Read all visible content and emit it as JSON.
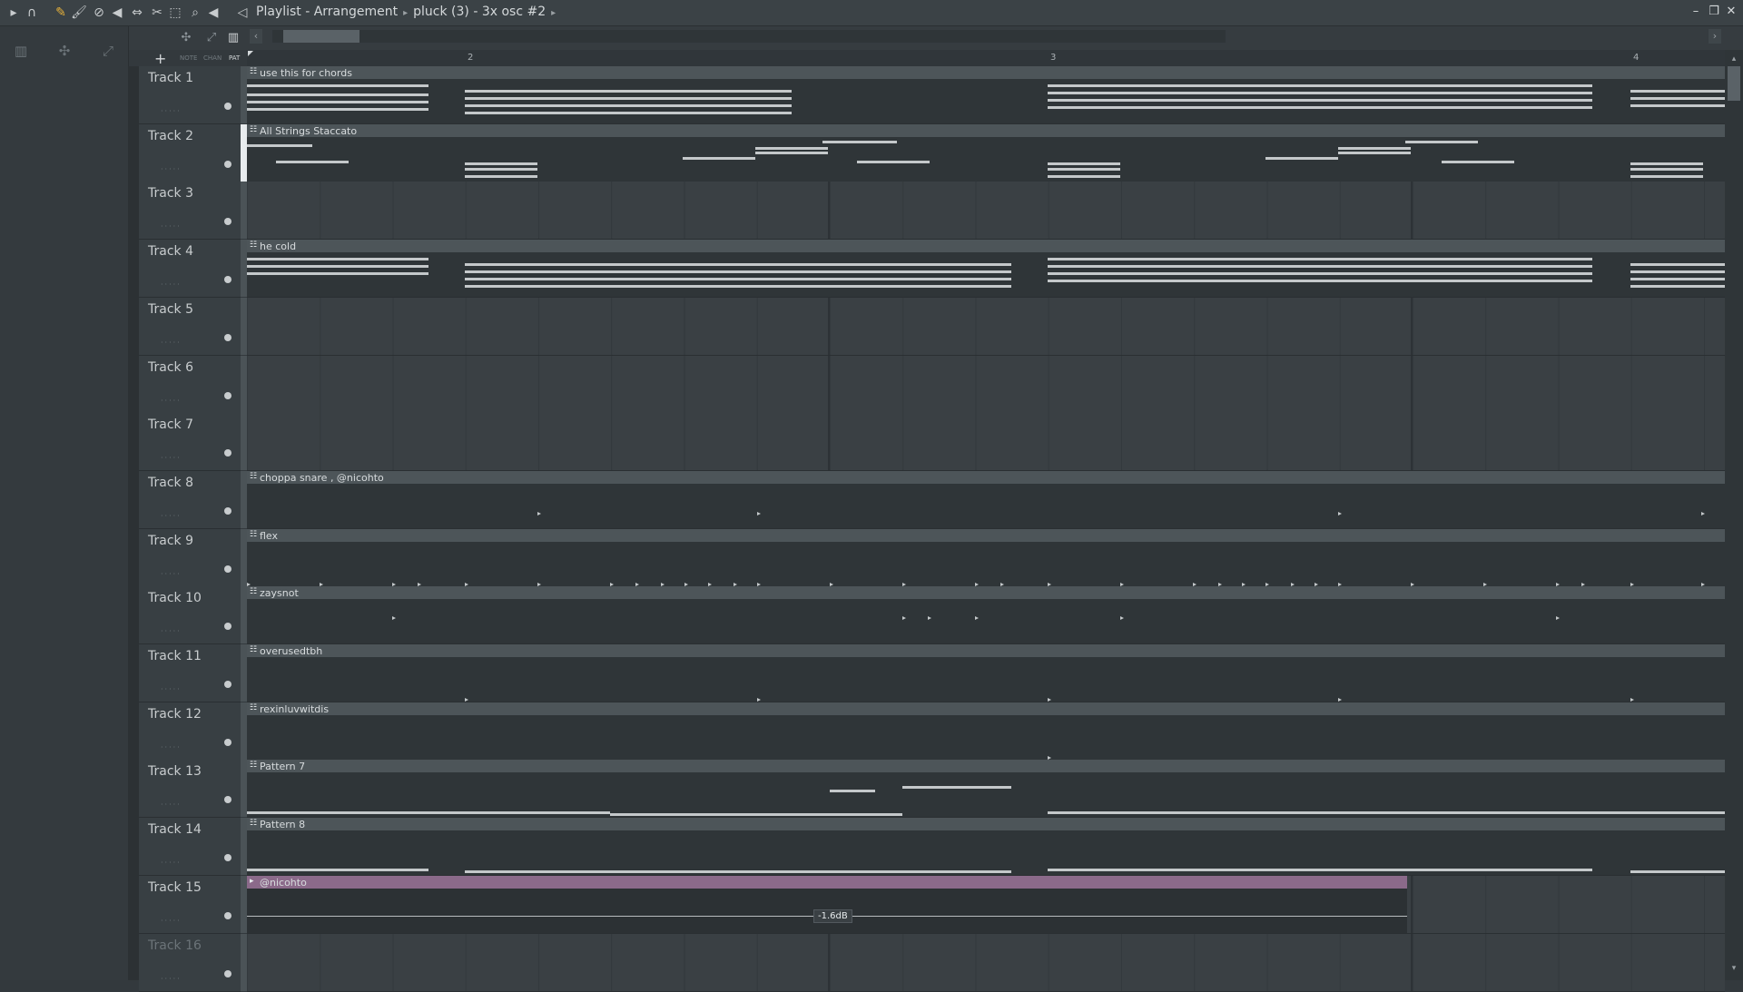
{
  "window": {
    "title": "Playlist - Arrangement",
    "pattern": "pluck (3) - 3x osc #2"
  },
  "ruler": {
    "bars": [
      "2",
      "3",
      "4"
    ]
  },
  "modes": {
    "note": "NOTE",
    "chan": "CHAN",
    "pat": "PAT"
  },
  "tracks": [
    {
      "name": "Track 1",
      "clip": "use this for chords"
    },
    {
      "name": "Track 2",
      "clip": "All Strings Staccato"
    },
    {
      "name": "Track 3",
      "clip": ""
    },
    {
      "name": "Track 4",
      "clip": "he cold"
    },
    {
      "name": "Track 5",
      "clip": ""
    },
    {
      "name": "Track 6",
      "clip": ""
    },
    {
      "name": "Track 7",
      "clip": ""
    },
    {
      "name": "Track 8",
      "clip": "choppa snare , @nicohto"
    },
    {
      "name": "Track 9",
      "clip": "flex"
    },
    {
      "name": "Track 10",
      "clip": "zaysnot"
    },
    {
      "name": "Track 11",
      "clip": "overusedtbh"
    },
    {
      "name": "Track 12",
      "clip": "rexinluvwitdis"
    },
    {
      "name": "Track 13",
      "clip": "Pattern 7"
    },
    {
      "name": "Track 14",
      "clip": "Pattern 8"
    },
    {
      "name": "Track 15",
      "clip": "@nicohto",
      "volume": "-1.6dB"
    },
    {
      "name": "Track 16",
      "clip": ""
    }
  ],
  "colors": {
    "audio_clip": "#8b6a8a",
    "pattern_clip": "#4d5559",
    "accent": "#e8b23a"
  },
  "icons": [
    "play-menu-icon",
    "magnet-icon",
    "pencil-icon",
    "paint-icon",
    "delete-icon",
    "mute-icon",
    "slip-icon",
    "slice-icon",
    "select-icon",
    "zoom-icon",
    "playback-icon"
  ]
}
